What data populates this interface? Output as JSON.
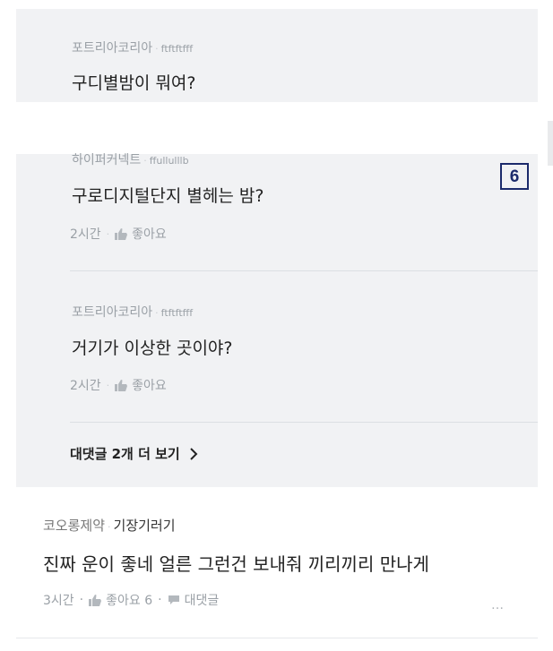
{
  "top_reply": {
    "author": "포트리아코리아",
    "nick": "ftftftfff",
    "text": "구디별밤이 뭐여?"
  },
  "reply_partial": {
    "author": "하이퍼커넥트",
    "nick": "ffullulllb",
    "text": "구로디지털단지 별헤는 밤?",
    "time": "2시간",
    "like_label": "좋아요"
  },
  "reply_second": {
    "author": "포트리아코리아",
    "nick": "ftftftfff",
    "text": "거기가 이상한 곳이야?",
    "time": "2시간",
    "like_label": "좋아요"
  },
  "more_replies_label": "대댓글 2개 더 보기",
  "badge_number": "6",
  "bottom_comment": {
    "author": "코오롱제약",
    "nick": "기장기러기",
    "text": "진짜 운이 좋네 얼른 그런건 보내줘 끼리끼리 만나게",
    "time": "3시간",
    "like_label": "좋아요 6",
    "reply_label": "대댓글",
    "more_icon": "…"
  },
  "separator_dot": "·",
  "colors": {
    "panel_bg": "#f1f2f4",
    "badge_border": "#1b2a6b",
    "muted_text": "#9aa0a6"
  }
}
